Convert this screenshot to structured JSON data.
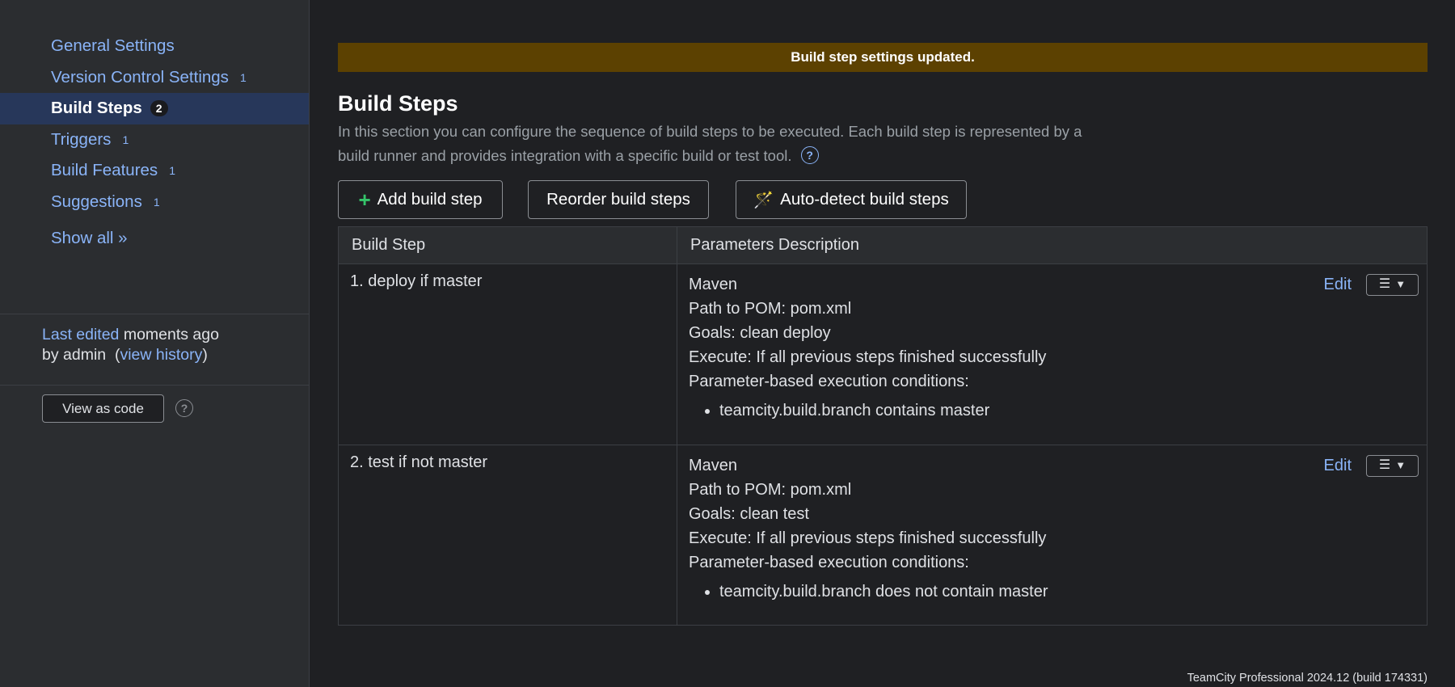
{
  "sidebar": {
    "items": [
      {
        "label": "General Settings",
        "count": ""
      },
      {
        "label": "Version Control Settings",
        "count": "1"
      },
      {
        "label": "Build Steps",
        "count": "2"
      },
      {
        "label": "Triggers",
        "count": "1"
      },
      {
        "label": "Build Features",
        "count": "1"
      },
      {
        "label": "Suggestions",
        "count": "1"
      }
    ],
    "active_index": 2,
    "show_all": "Show all »",
    "last_edited_label": "Last edited",
    "last_edited_time": "moments ago",
    "last_edited_by": "by admin",
    "view_history": "view history",
    "view_as_code": "View as code"
  },
  "banner": {
    "text": "Build step settings updated.",
    "color": "#5c4101"
  },
  "page": {
    "title": "Build Steps",
    "description": "In this section you can configure the sequence of build steps to be executed. Each build step is represented by a build runner and provides integration with a specific build or test tool."
  },
  "toolbar": {
    "add_label": "Add build step",
    "reorder_label": "Reorder build steps",
    "autodetect_label": "Auto-detect build steps"
  },
  "table": {
    "headers": [
      "Build Step",
      "Parameters Description"
    ],
    "rows": [
      {
        "name": "1. deploy if master",
        "runner": "Maven",
        "pom": "Path to POM: pom.xml",
        "goals": "Goals: clean deploy",
        "execute": "Execute: If all previous steps finished successfully",
        "conditions_label": "Parameter-based execution conditions:",
        "condition": "teamcity.build.branch contains master",
        "edit": "Edit"
      },
      {
        "name": "2. test if not master",
        "runner": "Maven",
        "pom": "Path to POM: pom.xml",
        "goals": "Goals: clean test",
        "execute": "Execute: If all previous steps finished successfully",
        "conditions_label": "Parameter-based execution conditions:",
        "condition": "teamcity.build.branch does not contain master",
        "edit": "Edit"
      }
    ]
  },
  "footer": {
    "text": "TeamCity Professional 2024.12 (build 174331)"
  },
  "icons": {
    "help": "help-circle-icon",
    "add": "plus-icon",
    "autodetect": "magic-wand-icon",
    "menu": "list-menu-icon"
  }
}
